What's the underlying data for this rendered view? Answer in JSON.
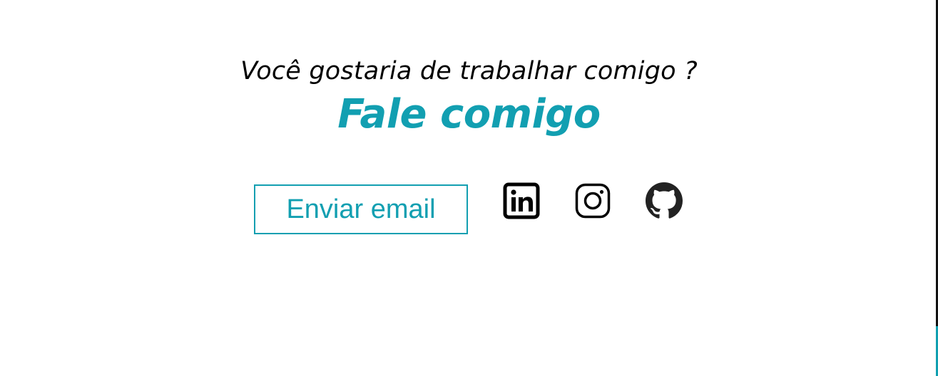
{
  "contact": {
    "question": "Você gostaria de trabalhar comigo ?",
    "headline": "Fale comigo",
    "email_button_label": "Enviar email"
  },
  "social_links": [
    {
      "icon": "linkedin-icon"
    },
    {
      "icon": "instagram-icon"
    },
    {
      "icon": "github-icon"
    }
  ],
  "colors": {
    "accent": "#129fb1",
    "text": "#000000",
    "background": "#ffffff"
  }
}
